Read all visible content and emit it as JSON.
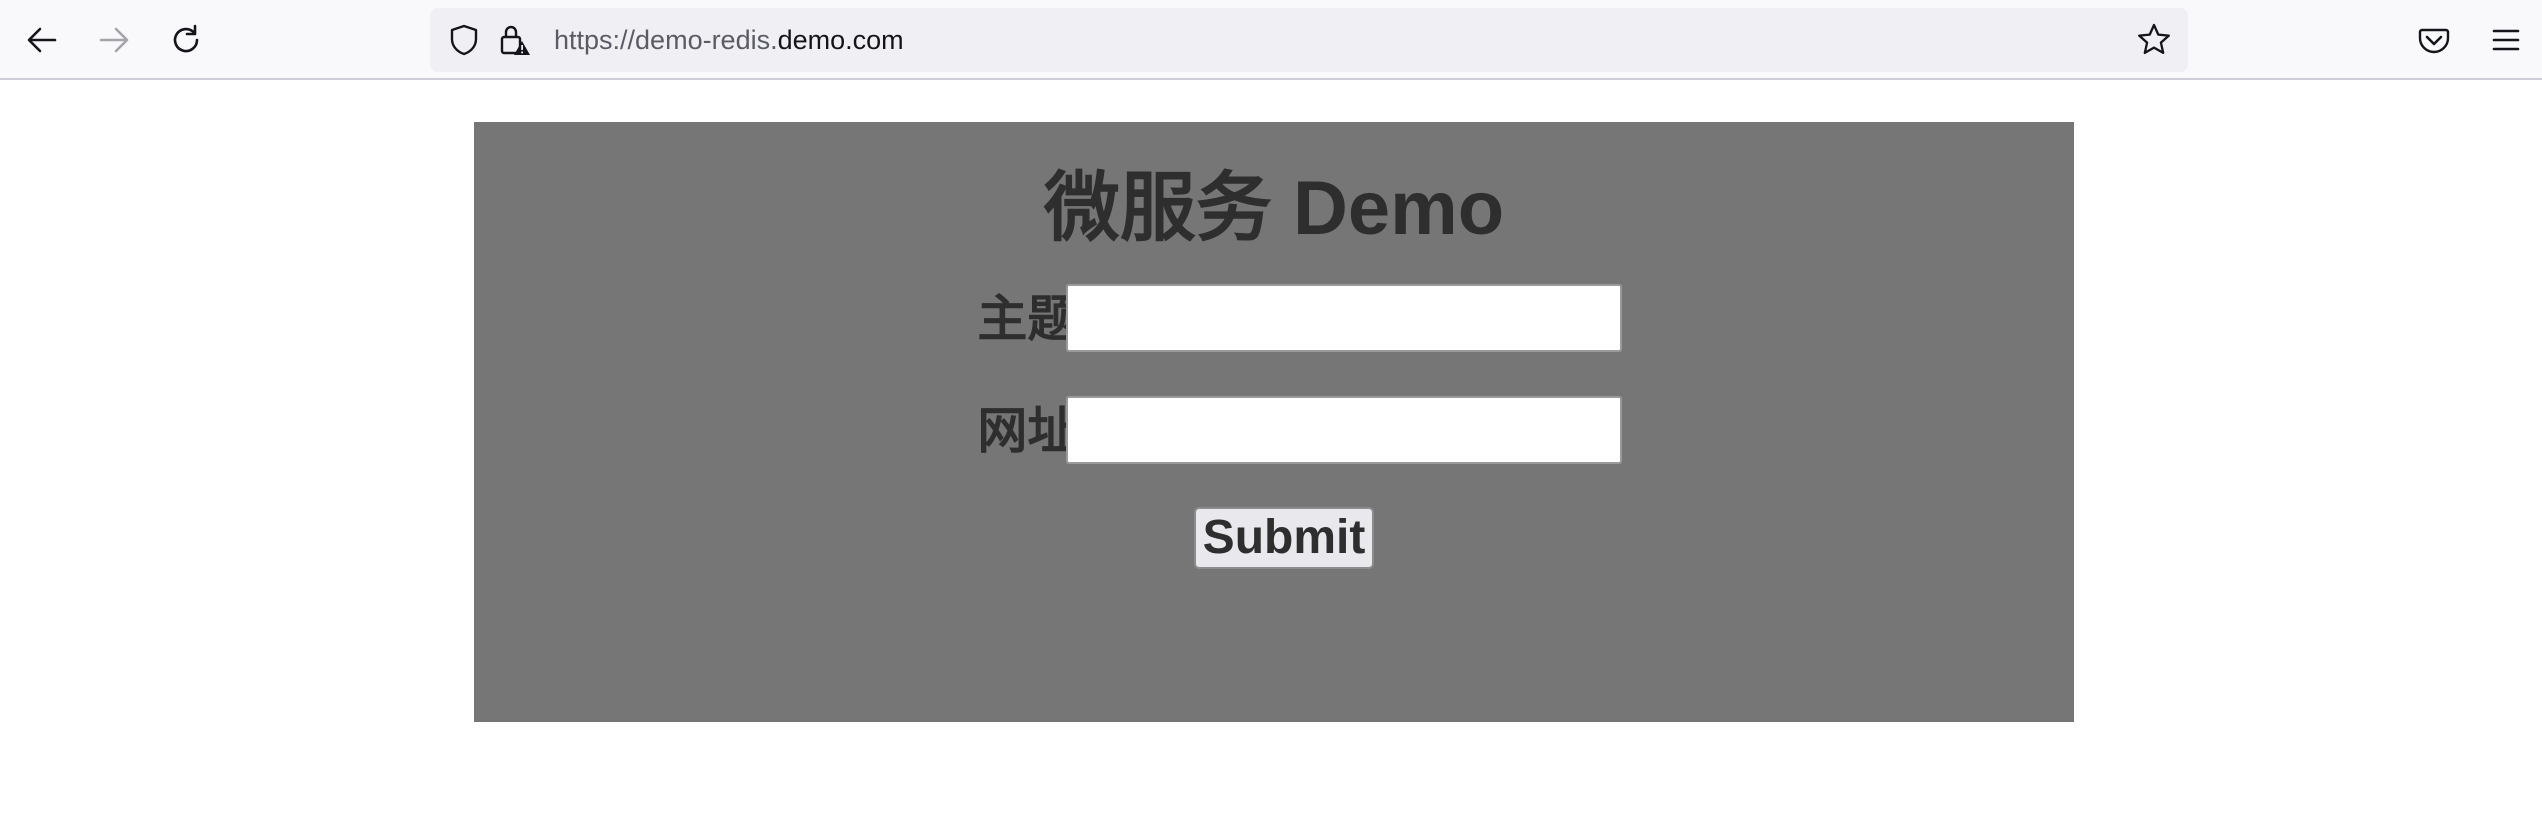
{
  "browser": {
    "url_prefix": "https://demo-redis.",
    "url_domain": "demo.com",
    "icons": {
      "back": "back-arrow-icon",
      "forward": "forward-arrow-icon",
      "reload": "reload-icon",
      "shield": "shield-icon",
      "lock": "lock-warning-icon",
      "bookmark": "star-icon",
      "pocket": "pocket-icon",
      "menu": "hamburger-menu-icon"
    }
  },
  "page": {
    "title": "微服务 Demo",
    "fields": [
      {
        "label": "主题:",
        "value": ""
      },
      {
        "label": "网址:",
        "value": ""
      }
    ],
    "submit_label": "Submit",
    "colors": {
      "panel_background": "#767676",
      "text": "#2e2e2e"
    }
  }
}
